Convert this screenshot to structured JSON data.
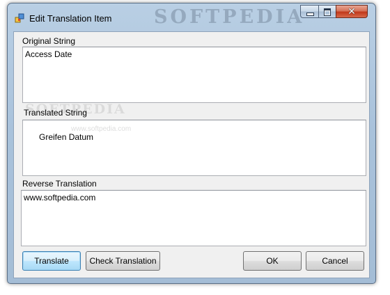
{
  "window": {
    "title": "Edit Translation Item",
    "title_watermark": "SOFTPEDIA",
    "controls": [
      "minimize",
      "maximize",
      "close"
    ],
    "icons": {
      "app": "app-icon",
      "close_glyph": "✕"
    }
  },
  "form": {
    "original_label": "Original String",
    "original_value": "Access Date",
    "translated_label": "Translated String",
    "translated_value": "Greifen Datum",
    "reverse_label": "Reverse Translation",
    "reverse_value": "www.softpedia.com"
  },
  "watermark": {
    "brand": "SOFTPEDIA",
    "url": "www.softpedia.com"
  },
  "buttons": {
    "translate": "Translate",
    "check": "Check Translation",
    "ok": "OK",
    "cancel": "Cancel"
  },
  "colors": {
    "frame": "#a9c2db",
    "client": "#f0f0f0",
    "close_button": "#c1391b",
    "default_button_border": "#3c7fb1"
  }
}
